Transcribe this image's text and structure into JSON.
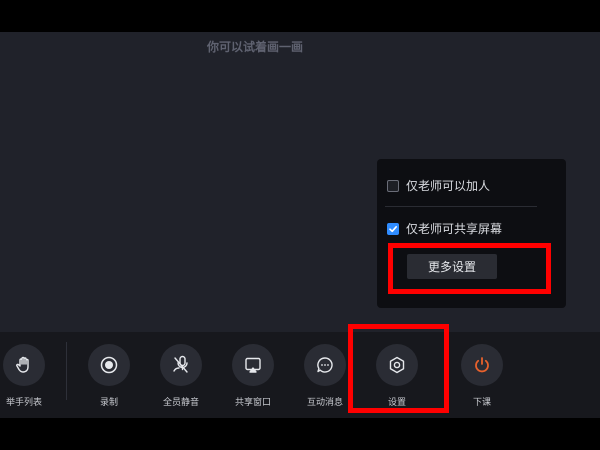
{
  "stage": {
    "hint": "你可以试着画一画"
  },
  "settings_popup": {
    "options": [
      {
        "label": "仅老师可以加人",
        "checked": false
      },
      {
        "label": "仅老师可共享屏幕",
        "checked": true
      }
    ],
    "more_settings_label": "更多设置"
  },
  "toolbar": {
    "items": [
      {
        "label": "举手列表",
        "icon": "raise-hand-icon"
      },
      {
        "label": "录制",
        "icon": "record-icon"
      },
      {
        "label": "全员静音",
        "icon": "mute-all-icon"
      },
      {
        "label": "共享窗口",
        "icon": "share-window-icon"
      },
      {
        "label": "互动消息",
        "icon": "message-icon"
      },
      {
        "label": "设置",
        "icon": "gear-icon"
      },
      {
        "label": "下课",
        "icon": "power-icon"
      }
    ]
  },
  "colors": {
    "stage_bg": "#20222a",
    "toolbar_bg": "#17181d",
    "checkbox_checked": "#2f8cff",
    "end_class_icon": "#e8612c",
    "highlight": "#ff0000"
  }
}
